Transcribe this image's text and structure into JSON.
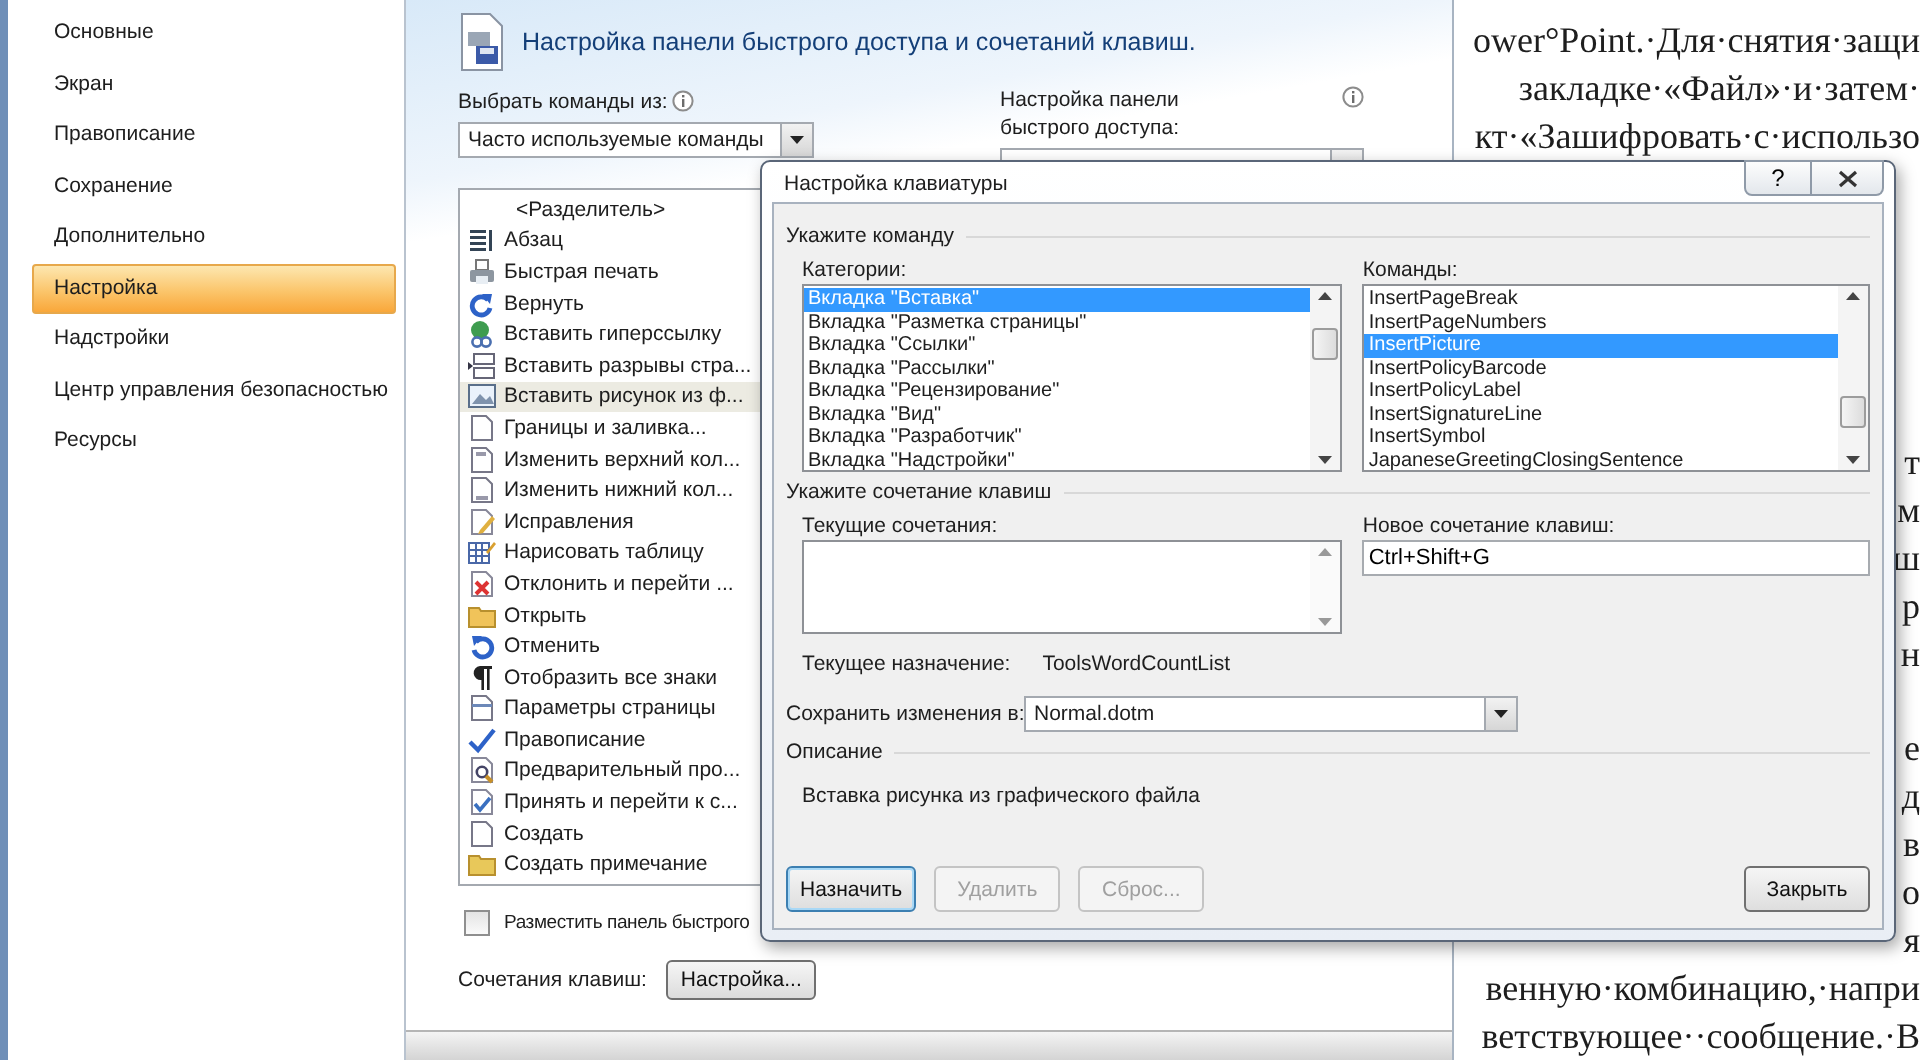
{
  "sidebar": {
    "items": [
      {
        "label": "Основные",
        "selected": false
      },
      {
        "label": "Экран",
        "selected": false
      },
      {
        "label": "Правописание",
        "selected": false
      },
      {
        "label": "Сохранение",
        "selected": false
      },
      {
        "label": "Дополнительно",
        "selected": false
      },
      {
        "label": "Настройка",
        "selected": true
      },
      {
        "label": "Надстройки",
        "selected": false
      },
      {
        "label": "Центр управления безопасностью",
        "selected": false
      },
      {
        "label": "Ресурсы",
        "selected": false
      }
    ]
  },
  "main": {
    "title": "Настройка панели быстрого доступа и сочетаний клавиш.",
    "choose_label": "Выбрать команды из:",
    "choose_value": "Часто используемые команды",
    "qat_label": "Настройка панели быстрого доступа:",
    "commands": [
      {
        "label": "<Разделитель>",
        "selected": false
      },
      {
        "label": "Абзац",
        "selected": false
      },
      {
        "label": "Быстрая печать",
        "selected": false
      },
      {
        "label": "Вернуть",
        "selected": false
      },
      {
        "label": "Вставить гиперссылку",
        "selected": false
      },
      {
        "label": "Вставить разрывы стра...",
        "selected": false
      },
      {
        "label": "Вставить рисунок из ф...",
        "selected": true
      },
      {
        "label": "Границы и заливка...",
        "selected": false
      },
      {
        "label": "Изменить верхний кол...",
        "selected": false
      },
      {
        "label": "Изменить нижний кол...",
        "selected": false
      },
      {
        "label": "Исправления",
        "selected": false
      },
      {
        "label": "Нарисовать таблицу",
        "selected": false
      },
      {
        "label": "Отклонить и перейти ...",
        "selected": false
      },
      {
        "label": "Открыть",
        "selected": false
      },
      {
        "label": "Отменить",
        "selected": false
      },
      {
        "label": "Отобразить все знаки",
        "selected": false
      },
      {
        "label": "Параметры страницы",
        "selected": false
      },
      {
        "label": "Правописание",
        "selected": false
      },
      {
        "label": "Предварительный про...",
        "selected": false
      },
      {
        "label": "Принять и перейти к с...",
        "selected": false
      },
      {
        "label": "Создать",
        "selected": false
      },
      {
        "label": "Создать примечание",
        "selected": false
      }
    ],
    "show_below": {
      "label": "Разместить панель быстрого",
      "checked": false
    },
    "shortcuts_label": "Сочетания клавиш:",
    "shortcuts_button": "Настройка..."
  },
  "dialog": {
    "title": "Настройка клавиатуры",
    "help_glyph": "?",
    "command_group": "Укажите команду",
    "categories_label": "Категории:",
    "categories": [
      {
        "label": "Вкладка \"Вставка\"",
        "selected": true
      },
      {
        "label": "Вкладка \"Разметка страницы\"",
        "selected": false
      },
      {
        "label": "Вкладка \"Ссылки\"",
        "selected": false
      },
      {
        "label": "Вкладка \"Рассылки\"",
        "selected": false
      },
      {
        "label": "Вкладка \"Рецензирование\"",
        "selected": false
      },
      {
        "label": "Вкладка \"Вид\"",
        "selected": false
      },
      {
        "label": "Вкладка \"Разработчик\"",
        "selected": false
      },
      {
        "label": "Вкладка \"Надстройки\"",
        "selected": false
      }
    ],
    "commands_label": "Команды:",
    "commands": [
      {
        "label": "InsertPageBreak",
        "selected": false
      },
      {
        "label": "InsertPageNumbers",
        "selected": false
      },
      {
        "label": "InsertPicture",
        "selected": true
      },
      {
        "label": "InsertPolicyBarcode",
        "selected": false
      },
      {
        "label": "InsertPolicyLabel",
        "selected": false
      },
      {
        "label": "InsertSignatureLine",
        "selected": false
      },
      {
        "label": "InsertSymbol",
        "selected": false
      },
      {
        "label": "JapaneseGreetingClosingSentence",
        "selected": false
      }
    ],
    "shortcut_group": "Укажите сочетание клавиш",
    "current_label": "Текущие сочетания:",
    "new_label": "Новое сочетание клавиш:",
    "new_value": "Ctrl+Shift+G",
    "assigned_label": "Текущее назначение:",
    "assigned_value": "ToolsWordCountList",
    "save_label": "Сохранить изменения в:",
    "save_value": "Normal.dotm",
    "description_group": "Описание",
    "description": "Вставка рисунка из графического файла",
    "buttons": [
      {
        "label": "Назначить",
        "disabled": false,
        "focused": true
      },
      {
        "label": "Удалить",
        "disabled": true,
        "focused": false
      },
      {
        "label": "Сброс...",
        "disabled": true,
        "focused": false
      }
    ],
    "close_button": "Закрыть"
  },
  "document": {
    "paragraphs": [
      {
        "lines": [
          "ower°Point.·Для·снятия·защи",
          "закладке·«Файл»·и·затем·",
          "кт·«Зашифровать·с·использо"
        ]
      },
      {
        "lines": [
          "т",
          "м",
          "ш",
          "р",
          "н"
        ]
      },
      {
        "lines": [
          "е",
          "д",
          "в",
          "о",
          "я",
          "венную·комбинацию,·напри",
          "ветствующее··сообщение.·В"
        ]
      }
    ]
  }
}
